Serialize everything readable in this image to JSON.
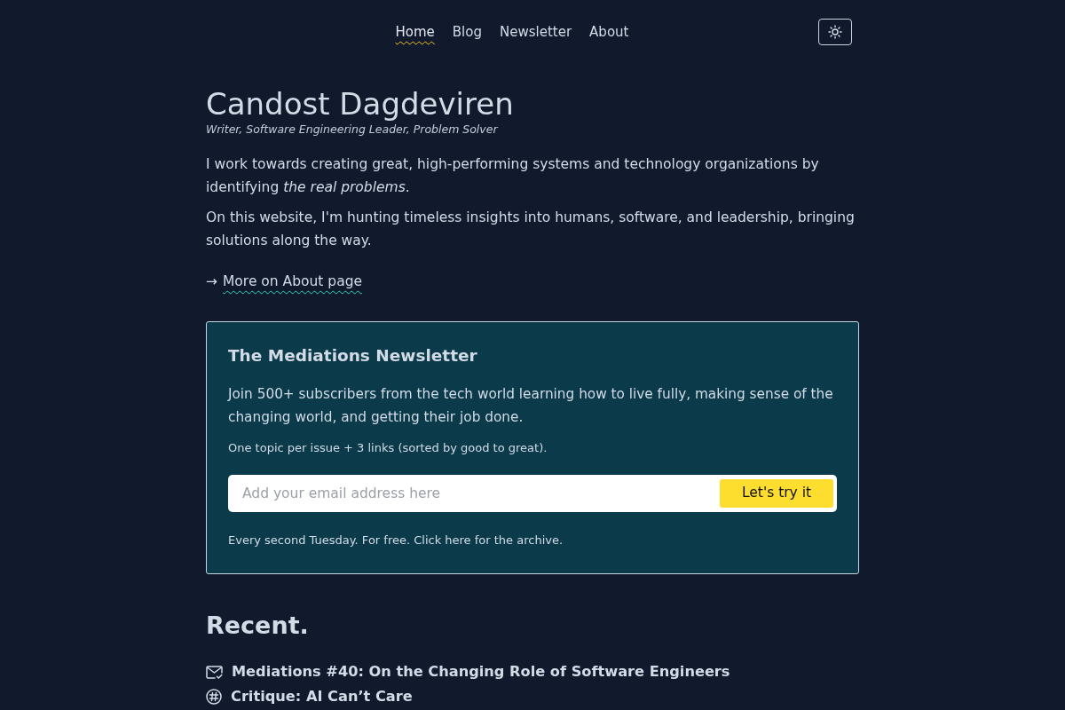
{
  "nav": {
    "items": [
      {
        "label": "Home",
        "selected": true
      },
      {
        "label": "Blog",
        "selected": false
      },
      {
        "label": "Newsletter",
        "selected": false
      },
      {
        "label": "About",
        "selected": false
      }
    ]
  },
  "header": {
    "name": "Candost Dagdeviren",
    "tagline": "Writer, Software Engineering Leader, Problem Solver"
  },
  "intro": {
    "paragraphs": [
      "I work towards creating great, high-performing systems and technology organizations by identifying *the real problems*.",
      "On this website, I'm hunting timeless insights into humans, software, and leadership, bringing solutions along the way."
    ],
    "link": {
      "arrow": "→",
      "label": "More on About page"
    }
  },
  "newsletter": {
    "title": "The Mediations Newsletter",
    "description": "Join 500+ subscribers from the tech world learning how to live fully, making sense of the changing world, and getting their job done.",
    "note": "One topic per issue + 3 links (sorted by good to great).",
    "email_field": {
      "placeholder": "Add your email address here"
    },
    "button": "Let's try it",
    "footer": "Every second Tuesday. For free. Click here for the archive."
  },
  "recent": {
    "heading": "Recent.",
    "posts": [
      {
        "kind": "newsletter",
        "title": "Mediations #40: On the Changing Role of Software Engineers"
      },
      {
        "kind": "article",
        "title": "Critique: AI Can’t Care"
      }
    ]
  }
}
